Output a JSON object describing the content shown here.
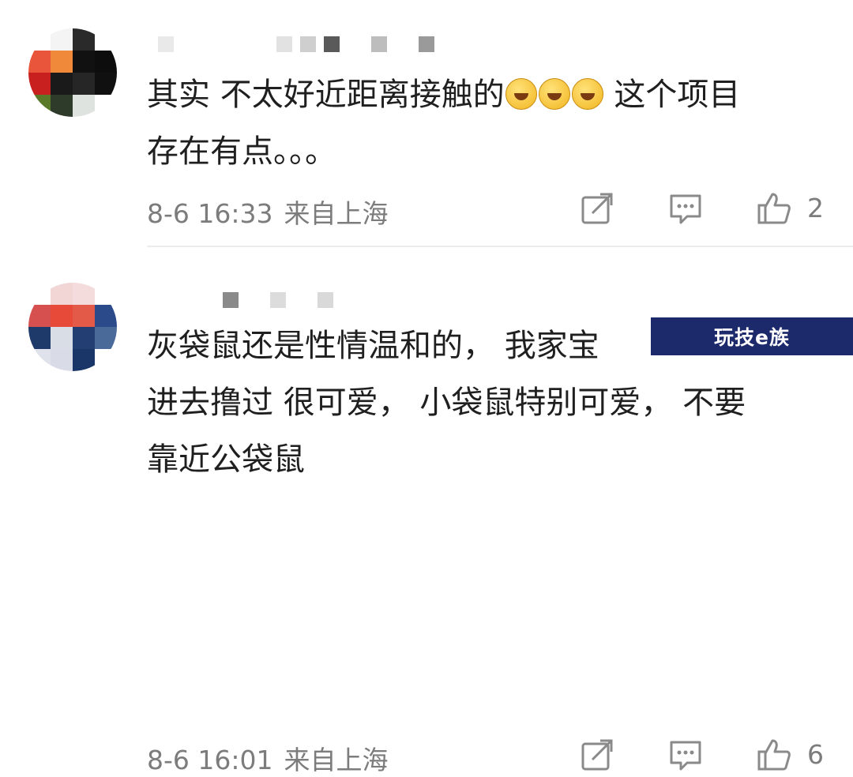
{
  "comments": [
    {
      "text_line1": "其实 不太好近距离接触的",
      "emojis": [
        "laugh-cry-emoji",
        "laugh-cry-emoji",
        "laugh-cry-emoji"
      ],
      "text_line1_after": " 这个项目",
      "text_line2": "存在有点。。。",
      "time": "8-6 16:33",
      "location": "来自上海",
      "likes": "2"
    },
    {
      "text_line1": "灰袋鼠还是性情温和的， 我家宝",
      "text_line2": "进去撸过 很可爱， 小袋鼠特别可爱， 不要",
      "text_line3": "靠近公袋鼠",
      "time": "8-6 16:01",
      "location": "来自上海",
      "likes": "6"
    }
  ],
  "watermark": "玩技e族",
  "icons": {
    "share": "share-icon",
    "reply": "comment-icon",
    "like": "thumbs-up-icon"
  },
  "colors": {
    "text": "#1f1f1f",
    "meta": "#7c7c7c",
    "icon": "#8a8a8a",
    "watermark_bg": "#1c2a6b"
  }
}
